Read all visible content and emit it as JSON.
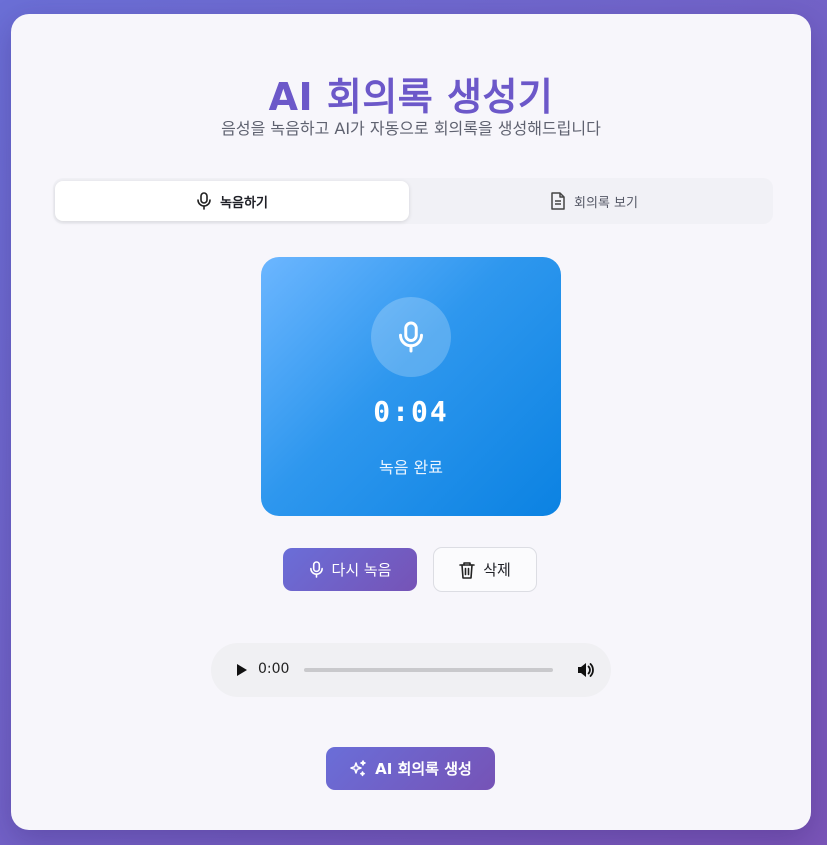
{
  "header": {
    "title": "AI 회의록 생성기",
    "subtitle": "음성을 녹음하고 AI가 자동으로 회의록을 생성해드립니다"
  },
  "tabs": [
    {
      "label": "녹음하기",
      "icon": "mic-icon",
      "active": true
    },
    {
      "label": "회의록 보기",
      "icon": "document-icon",
      "active": false
    }
  ],
  "recorder": {
    "icon": "mic-icon",
    "timer": "0:04",
    "status": "녹음 완료"
  },
  "actions": {
    "rerecord_label": "다시 녹음",
    "delete_label": "삭제"
  },
  "player": {
    "current_time": "0:00",
    "progress": 0
  },
  "generate": {
    "label": "AI 회의록 생성",
    "icon": "sparkles-icon"
  },
  "colors": {
    "accent": "#6c58c9",
    "recorder_panel": "#2e97ee"
  }
}
